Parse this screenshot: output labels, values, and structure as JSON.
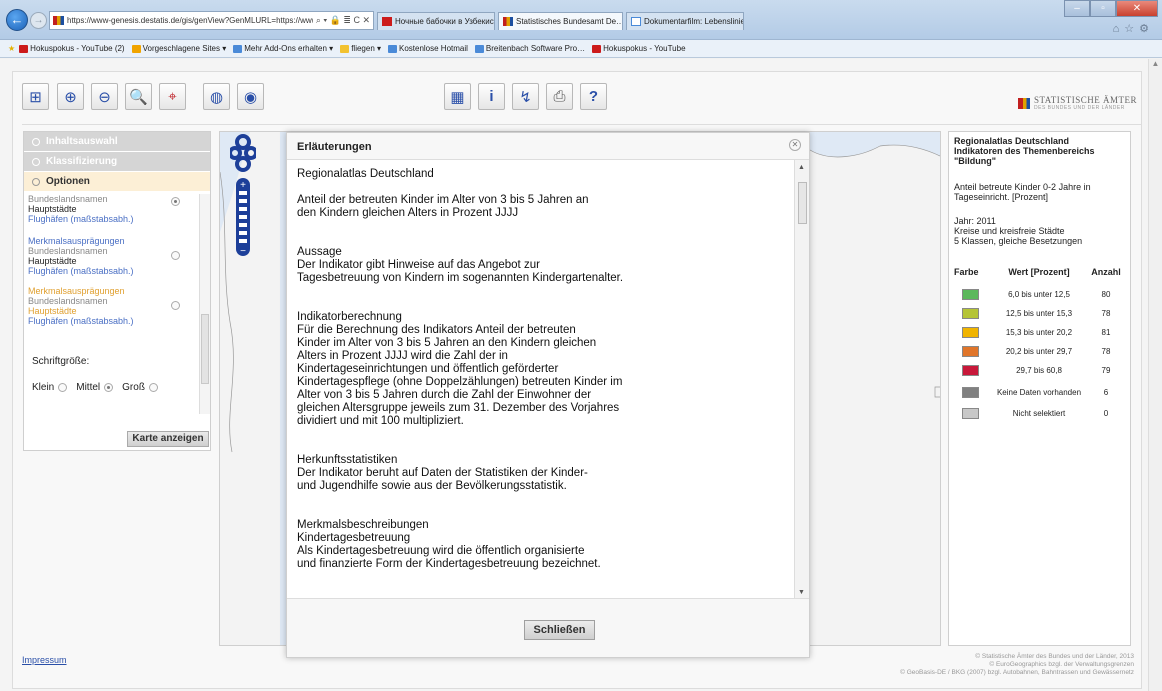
{
  "browser": {
    "url": "https://www-genesis.destatis.de/gis/genView?GenMLURL=https://www-genes",
    "address_controls": "⌕ ▾ 🔒 ≣ C ✕",
    "tabs": [
      {
        "label": "Ночные бабочки в Узбекиста…",
        "active": false
      },
      {
        "label": "Statistisches Bundesamt De…",
        "active": true
      },
      {
        "label": "Dokumentarfilm: Lebenslinien …",
        "active": false
      }
    ],
    "favorites": [
      {
        "label": "Hokuspokus - YouTube (2)",
        "color": "#cc1b1b"
      },
      {
        "label": "Vorgeschlagene Sites ▾",
        "color": "#f0a400"
      },
      {
        "label": "Mehr Add-Ons erhalten ▾",
        "color": "#4a8ad8"
      },
      {
        "label": "fliegen ▾",
        "color": "#f2c230"
      },
      {
        "label": "Kostenlose Hotmail",
        "color": "#4a8ad8"
      },
      {
        "label": "Breitenbach Software Pro…",
        "color": "#4a8ad8"
      },
      {
        "label": "Hokuspokus - YouTube",
        "color": "#cc1b1b"
      }
    ]
  },
  "logo": {
    "text": "STATISTISCHE ÄMTER",
    "subtext": "DES BUNDES UND DER LÄNDER"
  },
  "left_panel": {
    "sections": [
      "Inhaltsauswahl",
      "Klassifizierung",
      "Optionen"
    ],
    "options": [
      {
        "lines": [
          {
            "text": "Bundeslandsnamen",
            "color": "grey"
          },
          {
            "text": "Hauptstädte",
            "color": "black"
          },
          {
            "text": "Flughäfen (maßstabsabh.)",
            "color": "blue"
          }
        ],
        "selected": true
      },
      {
        "lines": [
          {
            "text": "Merkmalsausprägungen",
            "color": "blue"
          },
          {
            "text": "Bundeslandsnamen",
            "color": "grey"
          },
          {
            "text": "Hauptstädte",
            "color": "black"
          },
          {
            "text": "Flughäfen (maßstabsabh.)",
            "color": "blue"
          }
        ],
        "selected": false
      },
      {
        "lines": [
          {
            "text": "Merkmalsausprägungen",
            "color": "orange"
          },
          {
            "text": "Bundeslandsnamen",
            "color": "grey"
          },
          {
            "text": "Hauptstädte",
            "color": "orange"
          },
          {
            "text": "Flughäfen (maßstabsabh.)",
            "color": "blue"
          }
        ],
        "selected": false
      }
    ],
    "font_size_label": "Schriftgröße:",
    "font_sizes": [
      {
        "label": "Klein",
        "selected": false
      },
      {
        "label": "Mittel",
        "selected": true
      },
      {
        "label": "Groß",
        "selected": false
      }
    ],
    "show_map_button": "Karte anzeigen"
  },
  "dialog": {
    "title": "Erläuterungen",
    "close_label": "Schließen",
    "lines": [
      "Regionalatlas Deutschland",
      "",
      "Anteil der betreuten Kinder im Alter von 3 bis 5 Jahren an",
      "den Kindern gleichen Alters in Prozent JJJJ",
      "",
      "",
      "Aussage",
      "Der Indikator gibt Hinweise auf das Angebot zur",
      "Tagesbetreuung von Kindern im sogenannten Kindergartenalter.",
      "",
      "",
      "Indikatorberechnung",
      "Für die Berechnung des Indikators Anteil der betreuten",
      "Kinder im Alter von 3 bis 5 Jahren an den Kindern gleichen",
      "Alters in Prozent JJJJ wird die Zahl der in",
      "Kindertageseinrichtungen und öffentlich geförderter",
      "Kindertagespflege (ohne Doppelzählungen) betreuten Kinder im",
      "Alter von 3 bis 5 Jahren durch die Zahl der Einwohner der",
      "gleichen Altersgruppe jeweils zum 31. Dezember des Vorjahres",
      "dividiert und mit 100 multipliziert.",
      "",
      "",
      "Herkunftsstatistiken",
      "Der Indikator beruht auf Daten der Statistiken der Kinder-",
      "und Jugendhilfe sowie aus der Bevölkerungsstatistik.",
      "",
      "",
      "Merkmalsbeschreibungen",
      "Kindertagesbetreuung",
      "Als Kindertagesbetreuung wird die öffentlich organisierte",
      "und finanzierte Form der Kindertagesbetreuung bezeichnet."
    ]
  },
  "legend": {
    "title_lines": [
      "Regionalatlas Deutschland",
      "Indikatoren des Themenbereichs",
      "\"Bildung\""
    ],
    "indicator_lines": [
      "Anteil betreute Kinder 0-2 Jahre in",
      "Tageseinricht. [Prozent]"
    ],
    "meta_lines": [
      "Jahr: 2011",
      "Kreise und kreisfreie Städte",
      "5 Klassen, gleiche Besetzungen"
    ],
    "headers": {
      "color": "Farbe",
      "value": "Wert [Prozent]",
      "count": "Anzahl"
    },
    "rows": [
      {
        "color": "#5cb85c",
        "value": "6,0 bis unter 12,5",
        "count": "80"
      },
      {
        "color": "#b5c437",
        "value": "12,5 bis unter 15,3",
        "count": "78"
      },
      {
        "color": "#f0b400",
        "value": "15,3 bis unter 20,2",
        "count": "81"
      },
      {
        "color": "#e0752a",
        "value": "20,2 bis unter 29,7",
        "count": "78"
      },
      {
        "color": "#c8183a",
        "value": "29,7 bis 60,8",
        "count": "79"
      },
      {
        "color": "#808080",
        "value": "Keine Daten vorhanden",
        "count": "6"
      },
      {
        "color": "#c8c8c8",
        "value": "Nicht selektiert",
        "count": "0"
      }
    ]
  },
  "footer": {
    "impressum": "Impressum",
    "copyright_lines": [
      "© Statistische Ämter des Bundes und der Länder, 2013",
      "© EuroGeographics bzgl. der Verwaltungsgrenzen",
      "© GeoBasis-DE / BKG (2007) bzgl. Autobahnen, Bahntrassen und Gewässernetz"
    ]
  }
}
